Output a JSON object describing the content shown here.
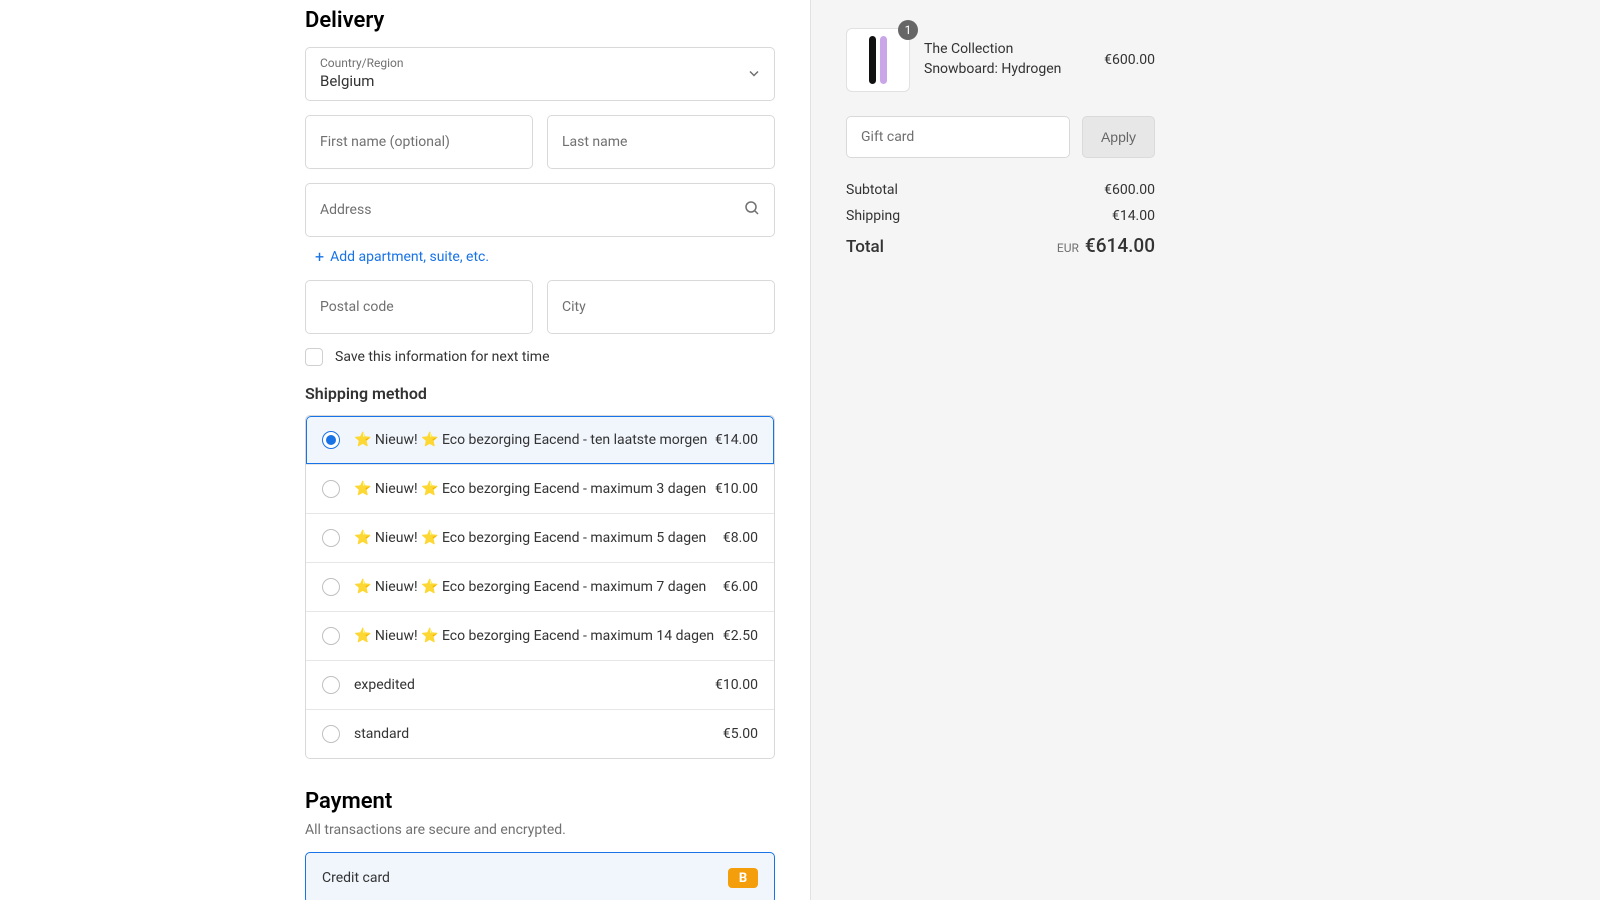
{
  "delivery": {
    "title": "Delivery",
    "country_label": "Country/Region",
    "country_value": "Belgium",
    "first_name_label": "First name (optional)",
    "last_name_label": "Last name",
    "address_label": "Address",
    "add_apartment": "Add apartment, suite, etc.",
    "postal_label": "Postal code",
    "city_label": "City",
    "save_info": "Save this information for next time"
  },
  "shipping": {
    "title": "Shipping method",
    "options": [
      {
        "label": "⭐ Nieuw! ⭐ Eco bezorging Eacend - ten laatste morgen",
        "price": "€14.00"
      },
      {
        "label": "⭐ Nieuw! ⭐ Eco bezorging Eacend - maximum 3 dagen",
        "price": "€10.00"
      },
      {
        "label": "⭐ Nieuw! ⭐ Eco bezorging Eacend - maximum 5 dagen",
        "price": "€8.00"
      },
      {
        "label": "⭐ Nieuw! ⭐ Eco bezorging Eacend - maximum 7 dagen",
        "price": "€6.00"
      },
      {
        "label": "⭐ Nieuw! ⭐ Eco bezorging Eacend - maximum 14 dagen",
        "price": "€2.50"
      },
      {
        "label": "expedited",
        "price": "€10.00"
      },
      {
        "label": "standard",
        "price": "€5.00"
      }
    ]
  },
  "payment": {
    "title": "Payment",
    "note": "All transactions are secure and encrypted.",
    "credit_card": "Credit card",
    "badge": "B"
  },
  "cart": {
    "qty": "1",
    "item_name": "The Collection Snowboard: Hydrogen",
    "item_price": "€600.00",
    "gift_placeholder": "Gift card",
    "apply": "Apply",
    "subtotal_label": "Subtotal",
    "subtotal_value": "€600.00",
    "shipping_label": "Shipping",
    "shipping_value": "€14.00",
    "total_label": "Total",
    "total_currency": "EUR",
    "total_value": "€614.00"
  }
}
